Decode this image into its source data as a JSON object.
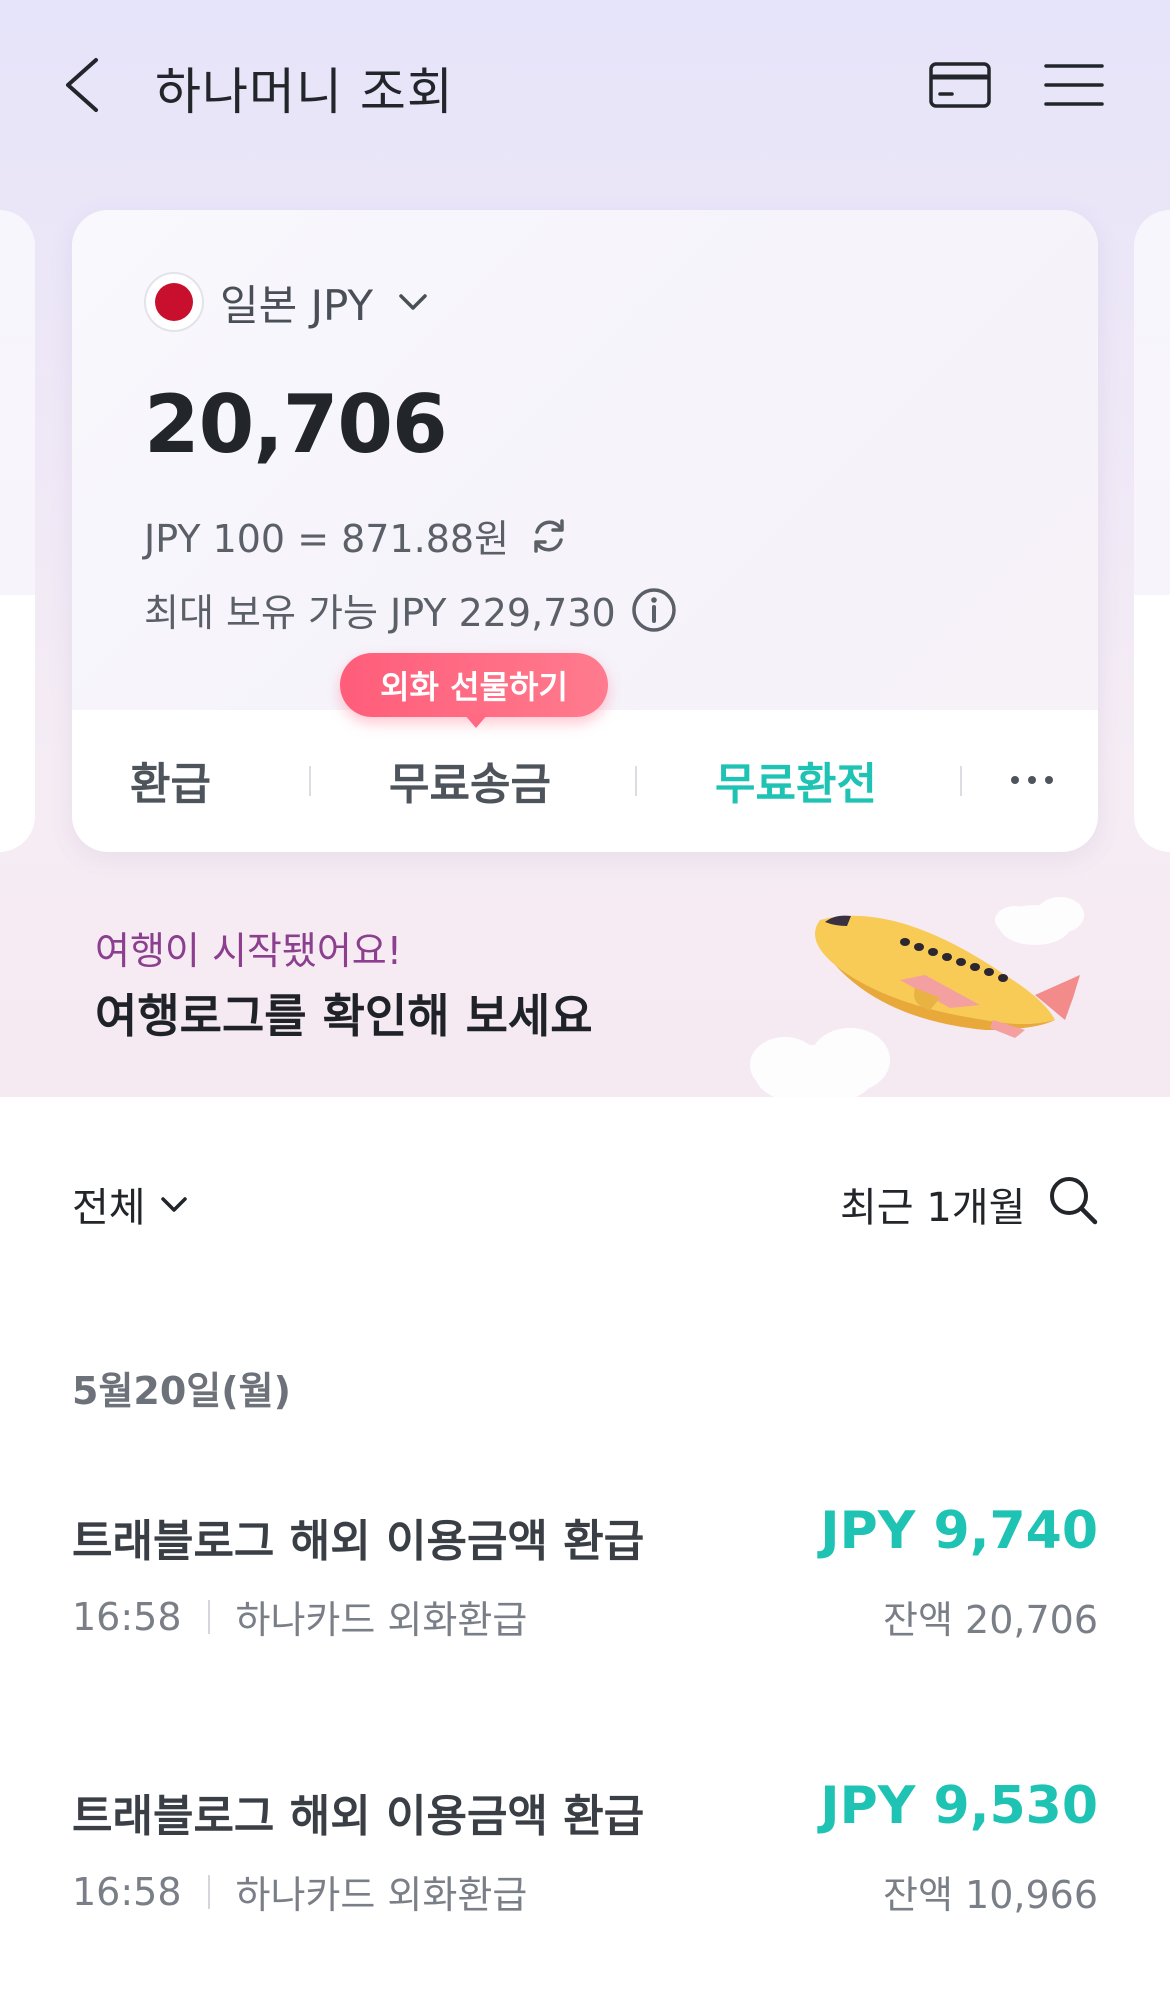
{
  "header": {
    "title": "하나머니 조회",
    "back_icon": "chevron-left-icon",
    "card_icon": "credit-card-icon",
    "menu_icon": "hamburger-menu-icon"
  },
  "currency_card": {
    "flag_icon": "japan-flag-icon",
    "currency_label": "일본 JPY",
    "balance": "20,706",
    "rate_text": "JPY 100 = 871.88원",
    "max_text": "최대 보유 가능 JPY 229,730",
    "gift_badge": "외화 선물하기",
    "actions": {
      "refund": "환급",
      "free_transfer": "무료송금",
      "free_exchange": "무료환전"
    }
  },
  "banner": {
    "subtitle": "여행이 시작됐어요!",
    "title": "여행로그를 확인해 보세요"
  },
  "filter": {
    "category": "전체",
    "period": "최근 1개월"
  },
  "transactions": {
    "date": "5월20일(월)",
    "items": [
      {
        "title": "트래블로그 해외 이용금액 환급",
        "time": "16:58",
        "source": "하나카드 외화환급",
        "amount": "JPY 9,740",
        "balance": "잔액 20,706"
      },
      {
        "title": "트래블로그 해외 이용금액 환급",
        "time": "16:58",
        "source": "하나카드 외화환급",
        "amount": "JPY 9,530",
        "balance": "잔액 10,966"
      }
    ]
  },
  "colors": {
    "accent_teal": "#1fc3b3",
    "badge_pink": "#ff5d7a",
    "banner_purple": "#8b3f8e"
  }
}
